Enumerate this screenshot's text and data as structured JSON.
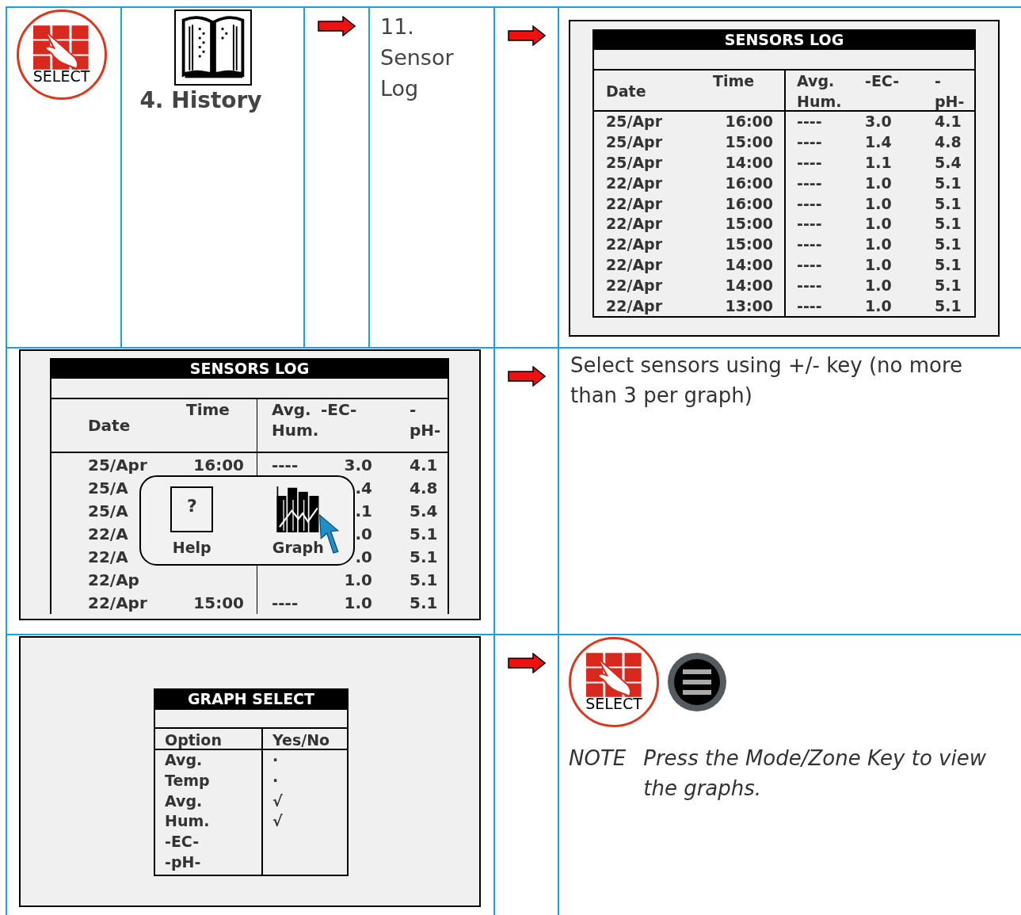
{
  "step_1": {
    "select_key": {
      "label": "SELECT"
    },
    "menu_item": "4. History",
    "submenu_item": "11. Sensor Log"
  },
  "sensors_log": {
    "title": "SENSORS LOG",
    "columns": [
      "Date",
      "Time",
      "Avg.\nHum.",
      "-EC-",
      "-\npH-"
    ],
    "rows": [
      [
        "25/Apr",
        "16:00",
        "----",
        "3.0",
        "4.1"
      ],
      [
        "25/Apr",
        "15:00",
        "----",
        "1.4",
        "4.8"
      ],
      [
        "25/Apr",
        "14:00",
        "----",
        "1.1",
        "5.4"
      ],
      [
        "22/Apr",
        "16:00",
        "----",
        "1.0",
        "5.1"
      ],
      [
        "22/Apr",
        "16:00",
        "----",
        "1.0",
        "5.1"
      ],
      [
        "22/Apr",
        "15:00",
        "----",
        "1.0",
        "5.1"
      ],
      [
        "22/Apr",
        "15:00",
        "----",
        "1.0",
        "5.1"
      ],
      [
        "22/Apr",
        "14:00",
        "----",
        "1.0",
        "5.1"
      ],
      [
        "22/Apr",
        "14:00",
        "----",
        "1.0",
        "5.1"
      ],
      [
        "22/Apr",
        "13:00",
        "----",
        "1.0",
        "5.1"
      ]
    ]
  },
  "sensors_log_with_popup": {
    "title": "SENSORS LOG",
    "columns": [
      "Date",
      "Time",
      "Avg.\nHum.",
      "-EC-",
      "-\npH-"
    ],
    "rows": [
      [
        "25/Apr",
        "16:00",
        "----",
        "3.0",
        "4.1"
      ],
      [
        "25/A",
        "",
        "",
        ".4",
        "4.8"
      ],
      [
        "25/A",
        "",
        "",
        ".1",
        "5.4"
      ],
      [
        "22/A",
        "",
        "",
        ".0",
        "5.1"
      ],
      [
        "22/A",
        "",
        "",
        ".0",
        "5.1"
      ],
      [
        "22/Ap",
        "",
        "",
        "1.0",
        "5.1"
      ],
      [
        "22/Apr",
        "15:00",
        "----",
        "1.0",
        "5.1"
      ]
    ],
    "popup": {
      "items": [
        {
          "kind": "help",
          "key": "?",
          "label": "Help"
        },
        {
          "kind": "graph",
          "label": "Graph"
        }
      ]
    }
  },
  "instruction": "Select sensors using +/- key (no more than 3 per graph)",
  "graph_select": {
    "title": "GRAPH SELECT",
    "columns": [
      "Option",
      "Yes/No"
    ],
    "rows": [
      {
        "option": "Avg.",
        "value": "·"
      },
      {
        "option": "Temp",
        "value": "·"
      },
      {
        "option": "Avg.",
        "value": "√"
      },
      {
        "option": "Hum.",
        "value": "√"
      },
      {
        "option": "-EC-"
      },
      {
        "option": "-pH-"
      }
    ]
  },
  "step_final": {
    "select_key": {
      "label": "SELECT"
    },
    "note_label": "NOTE",
    "note_text": "Press the Mode/Zone Key to view the graphs."
  }
}
